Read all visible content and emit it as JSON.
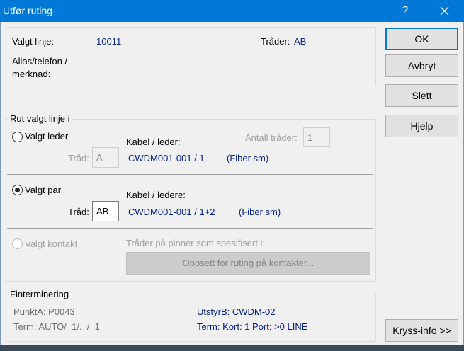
{
  "window": {
    "title": "Utfør ruting",
    "help_glyph": "?"
  },
  "info": {
    "valgt_linje_label": "Valgt linje:",
    "valgt_linje_value": "10011",
    "trader_label": "Tråder:",
    "trader_value": "AB",
    "alias_label_line1": "Alias/telefon /",
    "alias_label_line2": "merknad:",
    "alias_value": "-"
  },
  "routing": {
    "group_label": "Rut valgt linje i",
    "leder": {
      "radio_label": "Valgt leder",
      "selected": false,
      "traad_label": "Tråd:",
      "traad_value": "A",
      "kabel_label": "Kabel / leder:",
      "kabel_value": "CWDM001-001 / 1",
      "fiber_value": "(Fiber sm)",
      "antall_label": "Antall tråder:",
      "antall_value": "1"
    },
    "par": {
      "radio_label": "Valgt par",
      "selected": true,
      "traad_label": "Tråd:",
      "traad_value": "AB",
      "kabel_label": "Kabel / ledere:",
      "kabel_value": "CWDM001-001 / 1+2",
      "fiber_value": "(Fiber sm)"
    },
    "kontakt": {
      "radio_label": "Valgt kontakt",
      "selected": false,
      "pins_label": "Tråder på pinner som spesifisert i:",
      "setup_button": "Oppsett for ruting på kontakter..."
    }
  },
  "finterminering": {
    "label": "Finterminering",
    "punkt_a": "PunktA: P0043",
    "term_a": "Term: AUTO/  1/.  /  1",
    "utstyr_b": "UtstyrB: CWDM-02",
    "term_b": "Term: Kort: 1 Port: >0 LINE"
  },
  "buttons": {
    "ok": "OK",
    "avbryt": "Avbryt",
    "slett": "Slett",
    "hjelp": "Hjelp",
    "kryss_info": "Kryss-info >>"
  },
  "colors": {
    "titlebar": "#0078d7",
    "value_text": "#0a2a8a",
    "disabled_text": "#a0a0a0"
  }
}
